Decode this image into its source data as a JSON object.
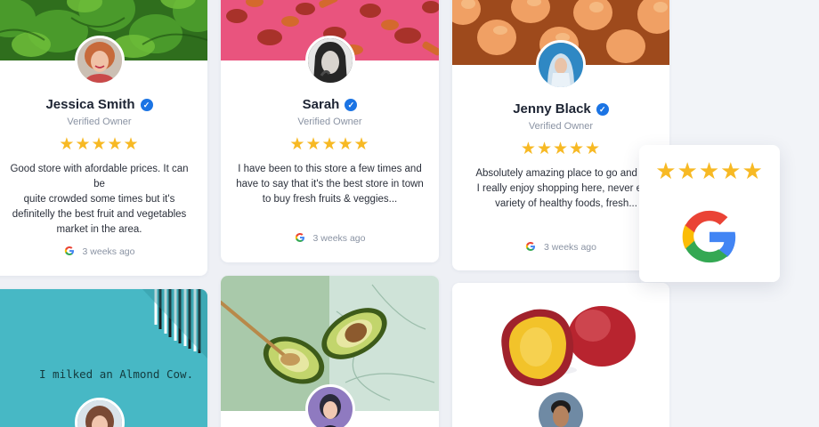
{
  "colors": {
    "star": "#f7b924",
    "verified": "#1b74e4",
    "background": "#eef0f5"
  },
  "reviews": [
    {
      "name": "Jessica Smith",
      "owner_label": "Verified Owner",
      "stars": "★★★★★",
      "rating": 5,
      "review_lines": [
        "Good store with afordable prices. It can be",
        "quite crowded some times but it's",
        "definitelly the best fruit and vegetables",
        "market in the area."
      ],
      "time": "3 weeks ago"
    },
    {
      "name": "Sarah",
      "owner_label": "Verified Owner",
      "stars": "★★★★★",
      "rating": 5,
      "review_lines": [
        "I have been to this store a few times and",
        "have to say that it's the best store in town",
        "to buy fresh fruits & veggies..."
      ],
      "time": "3 weeks ago"
    },
    {
      "name": "Jenny Black",
      "owner_label": "Verified Owner",
      "stars": "★★★★★",
      "rating": 5,
      "review_lines": [
        "Absolutely amazing place to go and sho",
        "I really enjoy shopping here, never endi",
        "variety of healthy foods, fresh..."
      ],
      "time": "3 weeks ago"
    }
  ],
  "google_badge": {
    "stars": "★★★★★",
    "rating": 5,
    "icon": "google-logo-icon"
  },
  "almond_photo": {
    "wall_text": "I milked an Almond Cow."
  },
  "check_glyph": "✓"
}
